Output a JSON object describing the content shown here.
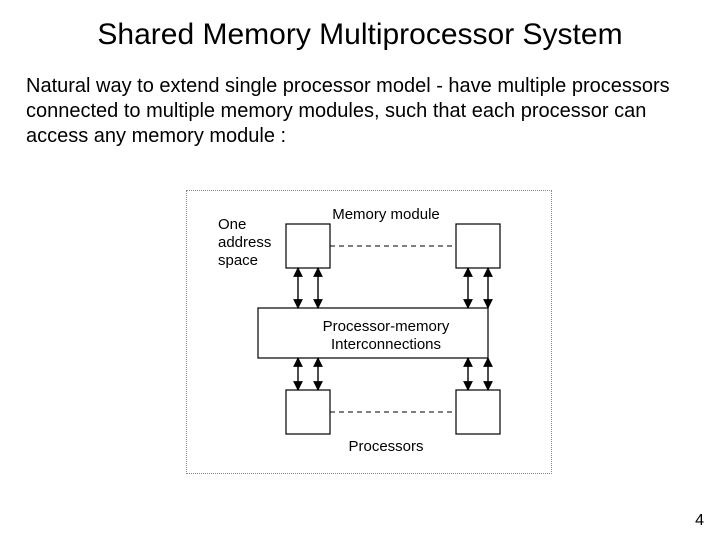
{
  "title": "Shared Memory Multiprocessor System",
  "body": "Natural way to extend single processor model - have multiple processors connected to multiple memory modules, such that each processor can access any memory module :",
  "labels": {
    "one_address_space": "One address space",
    "memory_module": "Memory module",
    "interconnections": "Processor-memory Interconnections",
    "processors": "Processors"
  },
  "page_number": "4"
}
